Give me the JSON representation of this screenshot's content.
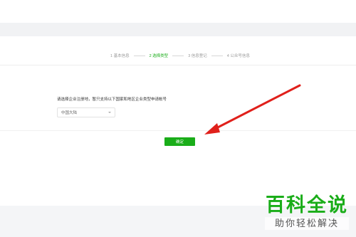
{
  "steps": [
    {
      "label": "1 基本信息",
      "active": false
    },
    {
      "label": "2 选择类型",
      "active": true
    },
    {
      "label": "3 信息登记",
      "active": false
    },
    {
      "label": "4 公众号信息",
      "active": false
    }
  ],
  "form": {
    "label": "请选择企业注册地，暂只支持以下国家和地区企业类型申请帐号",
    "region_select": {
      "value": "中国大陆"
    }
  },
  "actions": {
    "confirm_label": "确定"
  },
  "watermark": {
    "title": "百科全说",
    "subtitle": "助你轻松解决"
  },
  "colors": {
    "accent": "#1aad19",
    "arrow": "#e0201b"
  },
  "icons": {
    "select_chevron": "chevron-down-icon",
    "annotation": "red-arrow-icon"
  }
}
